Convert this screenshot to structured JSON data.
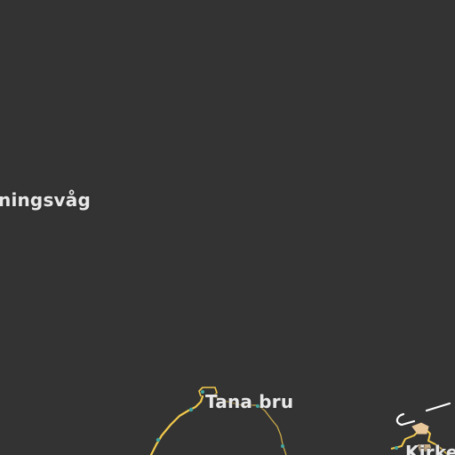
{
  "map": {
    "background_color": "#333333",
    "road_color": "#f2c94c",
    "minor_road_color": "#c9a94a",
    "label_color": "#e8e8e8",
    "node_color": "#3fa7a0",
    "places": [
      {
        "id": "honningsvag",
        "label": "ningsvåg"
      },
      {
        "id": "tana-bru",
        "label": "Tana bru"
      },
      {
        "id": "kirkenes",
        "label": "Kirke"
      }
    ]
  }
}
